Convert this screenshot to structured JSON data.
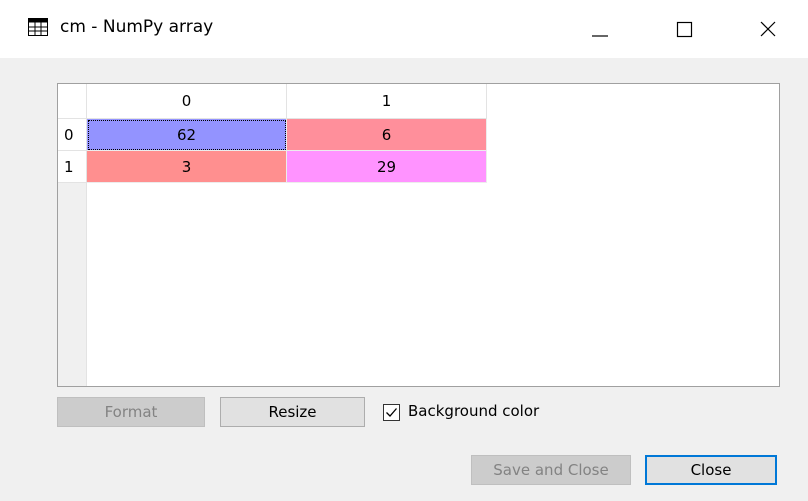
{
  "window": {
    "title": "cm - NumPy array"
  },
  "table": {
    "columns": [
      "0",
      "1"
    ],
    "rows": [
      {
        "header": "0",
        "cells": [
          {
            "value": "62",
            "color": "#9393ff"
          },
          {
            "value": "6",
            "color": "#ff8f9b"
          }
        ]
      },
      {
        "header": "1",
        "cells": [
          {
            "value": "3",
            "color": "#ff8f8f"
          },
          {
            "value": "29",
            "color": "#ff93ff"
          }
        ]
      }
    ]
  },
  "controls": {
    "format_label": "Format",
    "resize_label": "Resize",
    "background_color_label": "Background color",
    "background_color_checked": true,
    "save_close_label": "Save and Close",
    "close_label": "Close"
  }
}
